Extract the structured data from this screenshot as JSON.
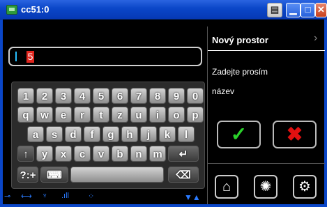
{
  "window": {
    "title": "cc51:0",
    "print_icon": "printer-icon",
    "minimize": "▁",
    "maximize": "□",
    "close": "✕"
  },
  "input": {
    "value": "5"
  },
  "keyboard": {
    "row1": [
      "1",
      "2",
      "3",
      "4",
      "5",
      "6",
      "7",
      "8",
      "9",
      "0"
    ],
    "row2": [
      "q",
      "w",
      "e",
      "r",
      "t",
      "z",
      "u",
      "i",
      "o",
      "p"
    ],
    "row3": [
      "a",
      "s",
      "d",
      "f",
      "g",
      "h",
      "j",
      "k",
      "l"
    ],
    "row4": [
      "y",
      "x",
      "c",
      "v",
      "b",
      "n",
      "m"
    ],
    "shift": "↑",
    "enter": "↵",
    "sym": "?:+",
    "backspace": "⌫"
  },
  "panel": {
    "title": "Nový prostor",
    "desc_line1": "Zadejte prosím",
    "desc_line2": "název",
    "ok": "✓",
    "cancel": "✖"
  },
  "status": {
    "chevron": "›",
    "arrows": "▼▲"
  }
}
